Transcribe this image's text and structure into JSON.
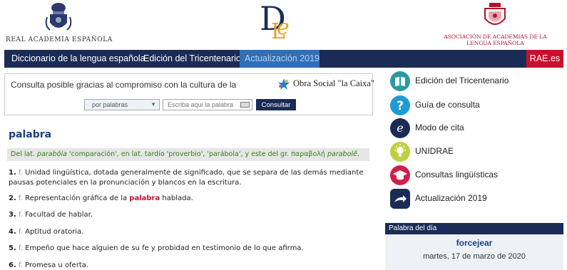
{
  "header": {
    "rae_name": "REAL ACADEMIA ESPAÑOLA",
    "asale_name": "ASOCIACIÓN DE ACADEMIAS DE LA LENGUA ESPAÑOLA"
  },
  "nav": {
    "items": [
      {
        "label": "Diccionario de la lengua española"
      },
      {
        "label": "Edición del Tricentenario"
      },
      {
        "label": "Actualización 2019",
        "active": true
      },
      {
        "label": "RAE.es"
      }
    ]
  },
  "search": {
    "sponsor_text": "Consulta posible gracias al compromiso con la cultura de la",
    "sponsor_name": "Obra Social \"la Caixa\"",
    "mode": "por palabras",
    "placeholder": "Escriba aquí la palabra",
    "button": "Consultar"
  },
  "entry": {
    "word": "palabra",
    "etymology": {
      "prefix": "Del lat. ",
      "term1": "parabŏla",
      "mid": " 'comparación', en lat. tardío 'proverbio', 'parábola', y este del gr. παραβολή ",
      "term2": "parabolḗ",
      "suffix": "."
    },
    "definitions": [
      {
        "num": "1.",
        "abbr": "f.",
        "text": "Unidad lingüística, dotada generalmente de significado, que se separa de las demás mediante pausas potenciales en la pronunciación y blancos en la escritura."
      },
      {
        "num": "2.",
        "abbr": "f.",
        "text_before": "Representación gráfica de la ",
        "highlight": "palabra",
        "text_after": " hablada."
      },
      {
        "num": "3.",
        "abbr": "f.",
        "text": "Facultad de hablar."
      },
      {
        "num": "4.",
        "abbr": "f.",
        "text": "Aptitud oratoria."
      },
      {
        "num": "5.",
        "abbr": "f.",
        "text": "Empeño que hace alguien de su fe y probidad en testimonio de lo que afirma."
      },
      {
        "num": "6.",
        "abbr": "f.",
        "text": "Promesa u oferta."
      }
    ]
  },
  "sidebar": {
    "items": [
      {
        "label": "Edición del Tricentenario",
        "icon": "book-icon"
      },
      {
        "label": "Guía de consulta",
        "icon": "question-icon"
      },
      {
        "label": "Modo de cita",
        "icon": "cite-icon"
      },
      {
        "label": "UNIDRAE",
        "icon": "lightbulb-icon"
      },
      {
        "label": "Consultas lingüísticas",
        "icon": "graduation-cap-icon"
      },
      {
        "label": "Actualización 2019",
        "icon": "arrow-icon"
      }
    ],
    "word_of_day": {
      "header": "Palabra del día",
      "word": "forcejear",
      "date": "martes, 17 de marzo de 2020"
    }
  },
  "colors": {
    "navy": "#1a2c56",
    "accent_red": "#c8102e",
    "active_blue": "#2f6fb8",
    "etymology_green": "#3b7b1f"
  }
}
